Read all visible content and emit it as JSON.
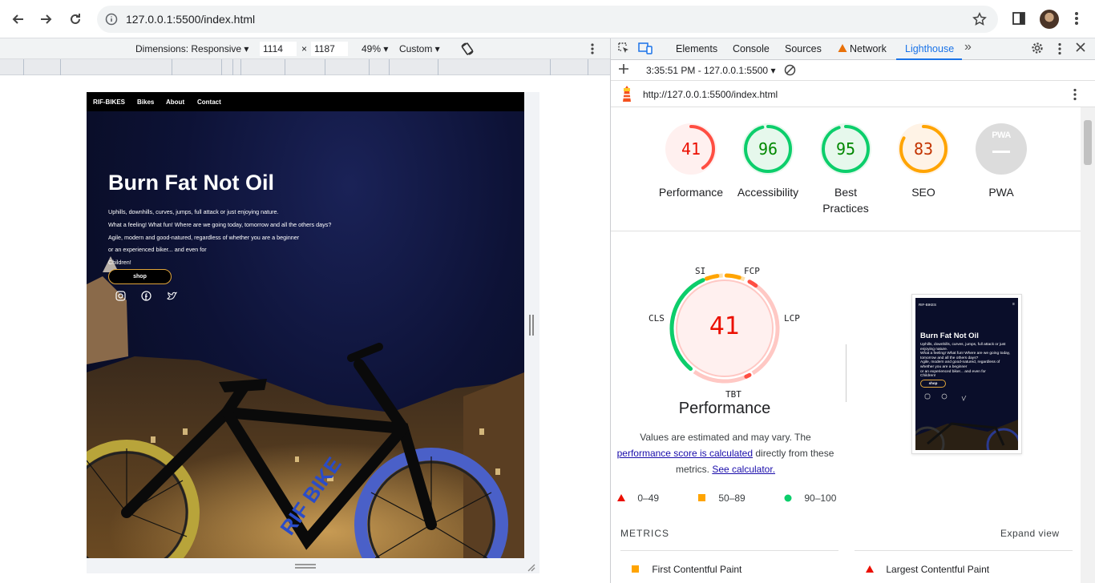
{
  "browser": {
    "url": "127.0.0.1:5500/index.html"
  },
  "device_toolbar": {
    "dimensions_label": "Dimensions: Responsive",
    "width": "1114",
    "times": "×",
    "height": "1187",
    "zoom": "49%",
    "throttle": "Custom"
  },
  "site": {
    "brand": "RIF-BIKES",
    "nav": [
      "Bikes",
      "About",
      "Contact"
    ],
    "heading": "Burn Fat Not Oil",
    "lines": [
      "Uphills, downhills, curves, jumps, full attack or just enjoying nature.",
      "What a feeling! What fun! Where are we going today, tomorrow and all the others days?",
      "Agile, modern and good-natured, regardless of whether you are a beginner",
      "or an experienced biker... and even for",
      "Children!"
    ],
    "shop_label": "shop",
    "bike_text": "RIF BIKE"
  },
  "devtools": {
    "tabs": [
      "Elements",
      "Console",
      "Sources",
      "Network",
      "Lighthouse"
    ],
    "more": "»",
    "report_time": "3:35:51 PM - 127.0.0.1:5500",
    "report_url": "http://127.0.0.1:5500/index.html"
  },
  "scores": [
    {
      "label": "Performance",
      "value": 41,
      "color": "#eb0f00",
      "bg": "#fff0ef"
    },
    {
      "label": "Accessibility",
      "value": 96,
      "color": "#008800",
      "bg": "#e6f8ec"
    },
    {
      "label": "Best Practices",
      "label1": "Best",
      "label2": "Practices",
      "value": 95,
      "color": "#008800",
      "bg": "#e6f8ec"
    },
    {
      "label": "SEO",
      "value": 83,
      "color": "#c33300",
      "bg": "#fff3e6"
    },
    {
      "label": "PWA",
      "value": "",
      "color": "#ffffff",
      "bg": "#dcdcdc"
    }
  ],
  "pwa_badge": "PWA",
  "performance": {
    "score": "41",
    "title": "Performance",
    "metric_labels": {
      "si": "SI",
      "fcp": "FCP",
      "lcp": "LCP",
      "tbt": "TBT",
      "cls": "CLS"
    },
    "desc_1": "Values are estimated and may vary. The",
    "desc_link_1": "performance score is calculated",
    "desc_2": " directly from these",
    "desc_3": "metrics. ",
    "desc_link_2": "See calculator."
  },
  "legend": [
    {
      "range": "0–49",
      "color": "#eb0f00"
    },
    {
      "range": "50–89",
      "color": "#ffa400"
    },
    {
      "range": "90–100",
      "color": "#0cce6b"
    }
  ],
  "metrics": {
    "header": "METRICS",
    "expand": "Expand view",
    "items": [
      {
        "name": "First Contentful Paint",
        "color": "#ffa400"
      },
      {
        "name": "Largest Contentful Paint",
        "color": "#eb0f00"
      }
    ]
  },
  "thumbnail": {
    "brand": "RIF-BIKES",
    "heading": "Burn Fat Not Oil",
    "lines": [
      "Uphills, downhills, curves, jumps, full attack or just",
      "enjoying nature.",
      "What a feeling! What fun! Where are we going today,",
      "tomorrow and all the others days?",
      "Agile, modern and good-natured, regardless of",
      "whether you are a beginner",
      "or an experienced biker... and even for",
      "Children!"
    ],
    "shop": "shop"
  }
}
